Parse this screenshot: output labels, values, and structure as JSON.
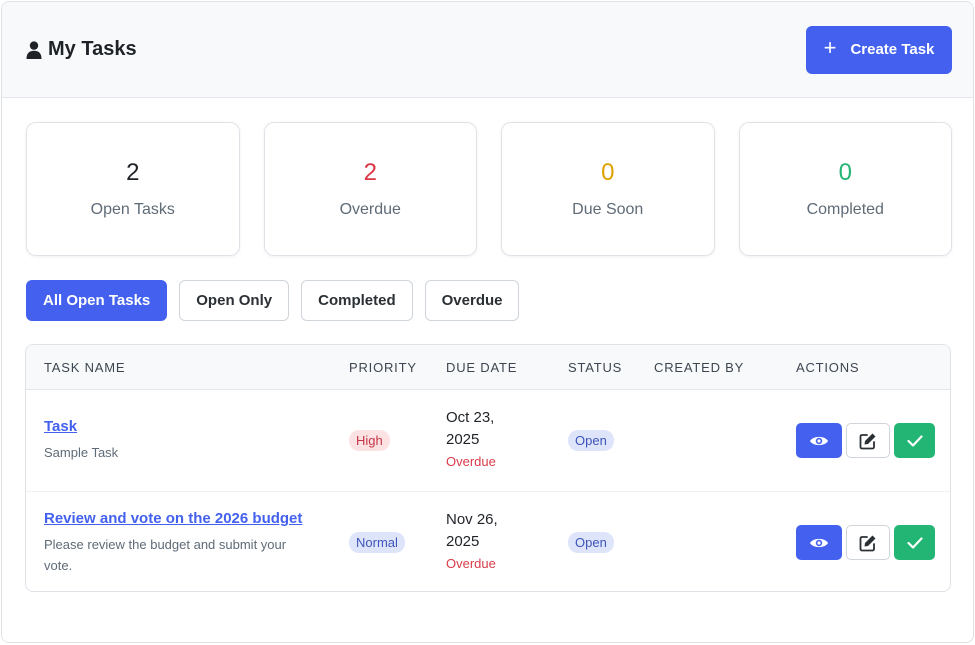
{
  "header": {
    "title": "My Tasks",
    "create_label": "Create Task"
  },
  "stats": [
    {
      "value": "2",
      "label": "Open Tasks",
      "color": "#1f2328"
    },
    {
      "value": "2",
      "label": "Overdue",
      "color": "#dc3545"
    },
    {
      "value": "0",
      "label": "Due Soon",
      "color": "#e0a100"
    },
    {
      "value": "0",
      "label": "Completed",
      "color": "#22b573"
    }
  ],
  "filters": [
    "All Open Tasks",
    "Open Only",
    "Completed",
    "Overdue"
  ],
  "table": {
    "columns": [
      "TASK NAME",
      "PRIORITY",
      "DUE DATE",
      "STATUS",
      "CREATED BY",
      "ACTIONS"
    ],
    "rows": [
      {
        "name": "Task",
        "description": "Sample Task",
        "priority": "High",
        "due_date": "Oct 23, 2025",
        "due_status": "Overdue",
        "status": "Open",
        "created_by": ""
      },
      {
        "name": "Review and vote on the 2026 budget",
        "description": "Please review the budget and submit your vote.",
        "priority": "Normal",
        "due_date": "Nov 26, 2025",
        "due_status": "Overdue",
        "status": "Open",
        "created_by": ""
      }
    ]
  },
  "icons": {
    "title": "user-icon",
    "create": "plus-icon",
    "view": "eye-icon",
    "edit": "edit-icon",
    "complete": "check-icon"
  }
}
